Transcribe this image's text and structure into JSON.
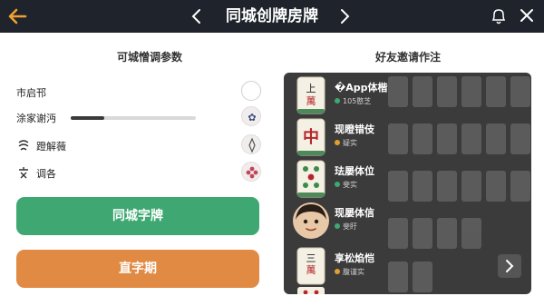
{
  "header": {
    "title": "同城创牌房牌",
    "icons": {
      "back": "arrow-left-icon",
      "prev": "chevron-left-icon",
      "next": "chevron-right-icon",
      "bell": "bell-icon",
      "close": "close-icon"
    },
    "colors": {
      "bar": "#1f232b",
      "back_arrow": "#f0a030"
    }
  },
  "left_panel": {
    "title": "可城憎调参数",
    "params": [
      {
        "label": "市启邗",
        "control": "toggle-circle"
      },
      {
        "label": "涂家谢沔",
        "control": "slider",
        "slider_level": 0.27
      },
      {
        "label": "蹬解薇",
        "icon": "swirl-icon",
        "control": "round-icon"
      },
      {
        "label": "调各",
        "icon": "cross-text-icon",
        "control": "round-icon"
      }
    ],
    "primary_button": "同城字牌",
    "secondary_button": "直字期",
    "colors": {
      "green": "#3fa872",
      "orange": "#e08a43"
    }
  },
  "right_panel": {
    "title": "好友邀请作注",
    "friends": [
      {
        "name": "�App体楷",
        "status": "105憨芝",
        "dot_color": "#3fa872",
        "tile": "上萬"
      },
      {
        "name": "现瞪错伎",
        "status": "疑实",
        "dot_color": "#e0a030",
        "tile": "中"
      },
      {
        "name": "珐屡体位",
        "status": "斐实",
        "dot_color": "#3fa872",
        "tile": "二筒"
      },
      {
        "name": "现屡体信",
        "status": "斐盱",
        "dot_color": "#3fa872",
        "tile": "avatar"
      },
      {
        "name": "享松焰恺",
        "status": "腹谨实",
        "dot_color": "#e0a030",
        "tile": "三萬"
      }
    ],
    "scroll_icon": "chevron-right-icon"
  }
}
